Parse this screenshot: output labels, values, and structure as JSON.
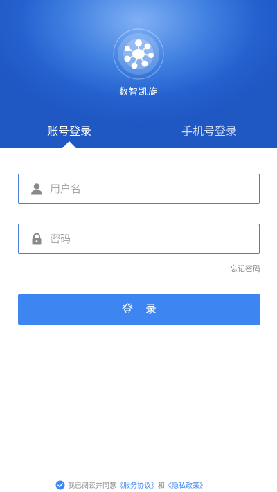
{
  "header": {
    "app_name": "数智凯旋",
    "tabs": {
      "account": "账号登录",
      "phone": "手机号登录"
    }
  },
  "form": {
    "username_placeholder": "用户名",
    "password_placeholder": "密码",
    "forgot_label": "忘记密码",
    "login_label": "登录"
  },
  "agreement": {
    "checked": true,
    "prefix": "我已阅读并同意",
    "service_link": "《服务协议》",
    "and_text": "和",
    "privacy_link": "《隐私政策》"
  },
  "colors": {
    "header_blue": "#2461cf",
    "accent": "#3d86f1",
    "field_border": "#4a7fd6"
  },
  "icons": {
    "logo": "app-logo-icon",
    "user": "user-icon",
    "lock": "lock-icon",
    "check": "check-circle-icon"
  }
}
